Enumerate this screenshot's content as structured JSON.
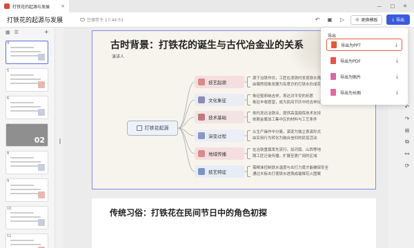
{
  "app": {
    "tab_title": "打铁花的起源与发展",
    "tab_close": "×",
    "window_controls": [
      "—",
      "□",
      "✕"
    ]
  },
  "toolbar": {
    "doc_title": "打铁花的起源与发展",
    "saved_status": "已保存于 17:44:53",
    "change_template_label": "更换模板",
    "export_label": "导出",
    "icons": [
      "undo-icon",
      "save-icon",
      "play-icon"
    ]
  },
  "sidebar": {
    "add_symbol": "+",
    "slides": [
      {
        "num": "4",
        "active": true
      },
      {
        "num": "5",
        "active": false
      },
      {
        "num": "6",
        "active": false
      },
      {
        "num": "7",
        "active": false,
        "dark": true,
        "big_text": "02"
      },
      {
        "num": "8",
        "active": false
      },
      {
        "num": "9",
        "active": false
      },
      {
        "num": "10",
        "active": false
      },
      {
        "num": "11",
        "active": false
      }
    ]
  },
  "slide1": {
    "title": "古时背景：打铁花的诞生与古代冶金业的关系",
    "presenter": "演讲人",
    "center_node": "打铁花起源",
    "branches": [
      {
        "label": "技艺起源",
        "color": "#f4dede",
        "icon_color": "#d98a8a",
        "leaves": [
          "源于冶铁作坊，工匠在泼铁时发现铁水溅射形成火花",
          "由偶然现象发展为有意识的打铁水形成花火效果"
        ]
      },
      {
        "label": "文化象征",
        "color": "#ececf3",
        "icon_color": "#8b8bb8",
        "leaves": [
          "象征驱邪纳吉祥，表达对平安的祈愿",
          "象征丰收愿望，成为民间节庆中的吉祥仪式"
        ]
      },
      {
        "label": "技术基础",
        "color": "#f2e4e4",
        "icon_color": "#c07a7a",
        "leaves": [
          "依托发达冶铁业，提供高温熔炼技术支持",
          "依赖金属加工集中区的材料与工艺条件"
        ]
      },
      {
        "label": "演变过程",
        "color": "#ebeef6",
        "icon_color": "#8898c6",
        "leaves": [
          "从生产操作中分离，演变为独立表演形式",
          "由实用行为转化为融合信仰的民俗活动"
        ]
      },
      {
        "label": "地域传播",
        "color": "#f4dede",
        "icon_color": "#d98a8a",
        "leaves": [
          "在冶铁重镇率先流行，如河南、山西等地",
          "随工匠迁徙传播，扩展至更广阔的区域"
        ]
      },
      {
        "label": "技艺特征",
        "color": "#e7ecf5",
        "icon_color": "#7a94c8",
        "leaves": [
          "需精准控制铁水温度与击打力度才能确保安全",
          "通过木板击打使铁水迸溅成璀璨花火图案"
        ]
      }
    ]
  },
  "slide2": {
    "title": "传统习俗：打铁花在民间节日中的角色初探"
  },
  "export_menu": {
    "title": "导出",
    "items": [
      {
        "label": "导出为PPT",
        "selected": true,
        "icon_color": "#e25a3e"
      },
      {
        "label": "导出为PDF",
        "selected": false,
        "icon_color": "#e0554a"
      },
      {
        "label": "导出为图片",
        "selected": false,
        "icon_color": "#d76aa6"
      },
      {
        "label": "导出为长图",
        "selected": false,
        "icon_color": "#e06aa0"
      }
    ],
    "download_symbol": "⤓"
  },
  "right_rail_icons": [
    "undo-icon",
    "redo-icon",
    "grid-icon",
    "layers-icon",
    "connect-icon",
    "rotate-icon"
  ]
}
